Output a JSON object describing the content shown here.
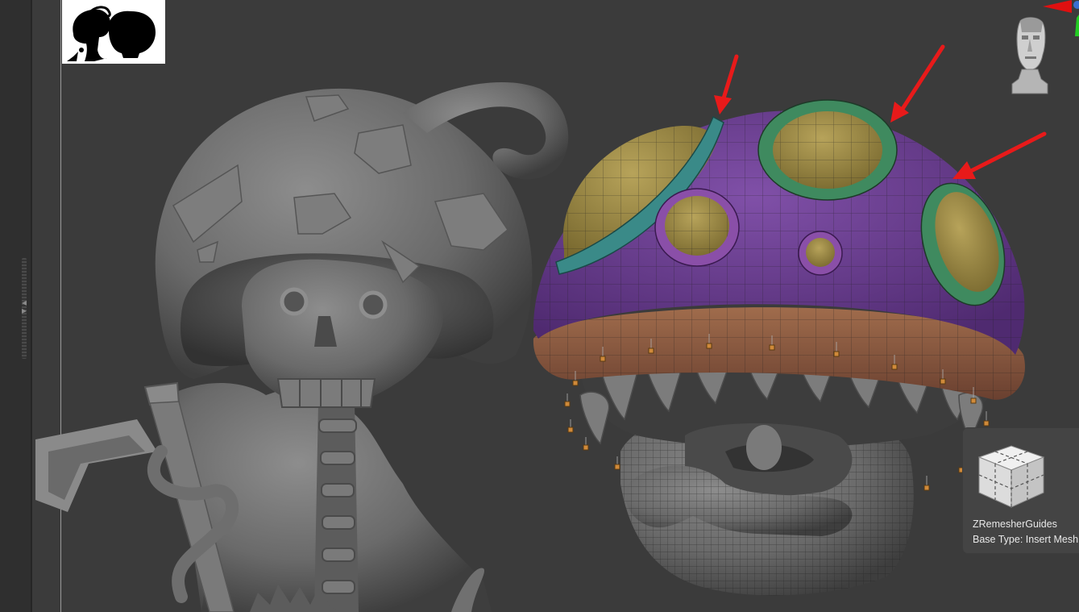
{
  "viewport": {
    "background": "#3b3b3b",
    "left_strip_color": "#2f2f2f",
    "accent_arrow_color": "#e81a1a"
  },
  "reference_image": {
    "icon": "mushroom-silhouette-reference"
  },
  "gizmos": {
    "head": {
      "icon": "head-orientation-gizmo"
    },
    "axis": {
      "icon": "axis-gizmo",
      "colors": [
        "#e01010",
        "#22cc22"
      ]
    }
  },
  "polygroup_colors": {
    "cap": "#6f3f94",
    "rim": "#8f5f45",
    "spots": "#9c8a45",
    "ring_teal": "#3a8a88",
    "ring_green": "#3f8a5f",
    "ring_purple": "#8a4fa8",
    "curve_point": "#d08a3a"
  },
  "brush_thumbnail": {
    "icon": "cube-insert-mesh-icon",
    "title": "ZRemesherGuides",
    "subtitle": "Base Type: Insert Mesh"
  }
}
